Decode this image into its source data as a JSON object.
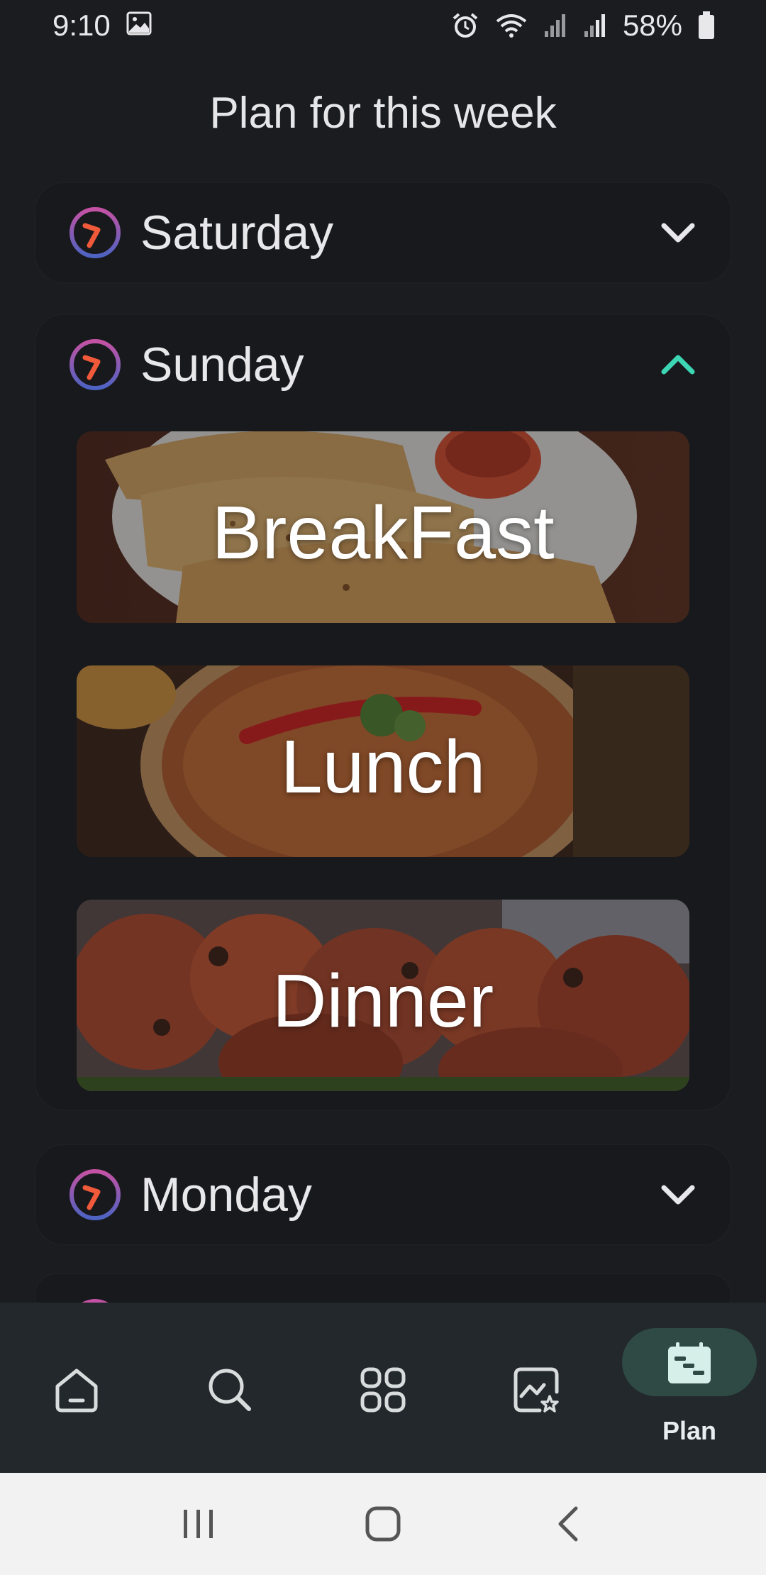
{
  "status_bar": {
    "time": "9:10",
    "battery": "58%",
    "icons": [
      "image-icon",
      "alarm-icon",
      "wifi-icon",
      "signal-icon",
      "signal-icon",
      "battery-icon"
    ]
  },
  "page": {
    "title": "Plan for this week"
  },
  "days": [
    {
      "label": "Saturday",
      "expanded": false
    },
    {
      "label": "Sunday",
      "expanded": true,
      "meals": [
        "BreakFast",
        "Lunch",
        "Dinner"
      ]
    },
    {
      "label": "Monday",
      "expanded": false
    }
  ],
  "bottom_nav": {
    "items": [
      {
        "icon": "home-icon"
      },
      {
        "icon": "search-icon"
      },
      {
        "icon": "grid-icon"
      },
      {
        "icon": "favorites-icon"
      },
      {
        "icon": "plan-icon",
        "label": "Plan",
        "active": true
      }
    ]
  },
  "colors": {
    "background": "#1b1c20",
    "accent": "#3dd6b5",
    "nav_active_pill": "#2f4a44"
  }
}
